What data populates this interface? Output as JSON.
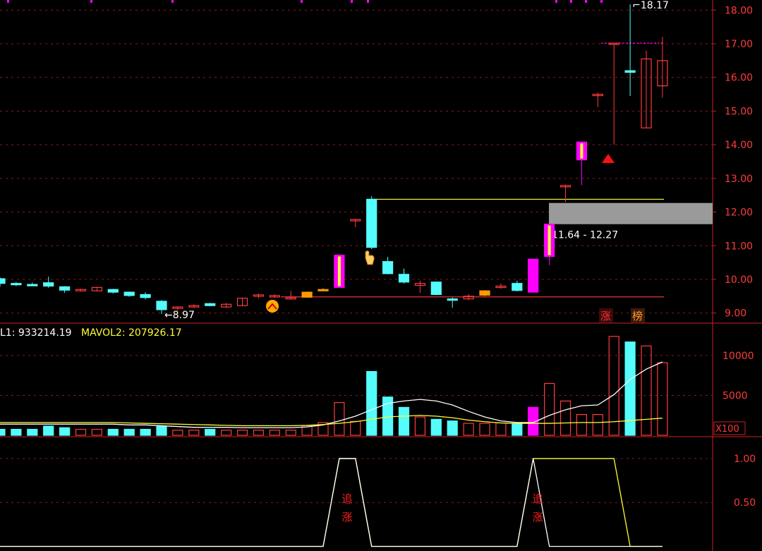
{
  "colors": {
    "up": "#ff3b3b",
    "down": "#54fcfc",
    "limit_up": "#ff00ff",
    "axis": "#cc2020",
    "grid": "#8a1a1a",
    "yellow": "#ffff33",
    "white": "#ffffff",
    "gray_zone": "#9a9a9a"
  },
  "chart_data": [
    {
      "type": "candlestick",
      "ylim": [
        8.7,
        18.3
      ],
      "y_ticks": [
        9.0,
        10.0,
        11.0,
        12.0,
        13.0,
        14.0,
        15.0,
        16.0,
        17.0,
        18.0
      ],
      "candles": [
        {
          "o": 10.02,
          "h": 10.06,
          "l": 9.78,
          "c": 9.88,
          "kind": "down"
        },
        {
          "o": 9.88,
          "h": 9.92,
          "l": 9.8,
          "c": 9.85,
          "kind": "down"
        },
        {
          "o": 9.85,
          "h": 9.9,
          "l": 9.82,
          "c": 9.83,
          "kind": "down"
        },
        {
          "o": 9.9,
          "h": 10.08,
          "l": 9.75,
          "c": 9.8,
          "kind": "down"
        },
        {
          "o": 9.78,
          "h": 9.8,
          "l": 9.6,
          "c": 9.68,
          "kind": "down"
        },
        {
          "o": 9.67,
          "h": 9.72,
          "l": 9.64,
          "c": 9.7,
          "kind": "up"
        },
        {
          "o": 9.66,
          "h": 9.78,
          "l": 9.64,
          "c": 9.76,
          "kind": "up"
        },
        {
          "o": 9.7,
          "h": 9.72,
          "l": 9.58,
          "c": 9.62,
          "kind": "down"
        },
        {
          "o": 9.62,
          "h": 9.64,
          "l": 9.48,
          "c": 9.52,
          "kind": "down"
        },
        {
          "o": 9.55,
          "h": 9.62,
          "l": 9.4,
          "c": 9.46,
          "kind": "down"
        },
        {
          "o": 9.35,
          "h": 9.38,
          "l": 8.97,
          "c": 9.1,
          "kind": "down"
        },
        {
          "o": 9.15,
          "h": 9.2,
          "l": 9.08,
          "c": 9.18,
          "kind": "up"
        },
        {
          "o": 9.2,
          "h": 9.26,
          "l": 9.16,
          "c": 9.22,
          "kind": "up"
        },
        {
          "o": 9.28,
          "h": 9.3,
          "l": 9.2,
          "c": 9.22,
          "kind": "down"
        },
        {
          "o": 9.18,
          "h": 9.3,
          "l": 9.15,
          "c": 9.26,
          "kind": "up"
        },
        {
          "o": 9.22,
          "h": 9.46,
          "l": 9.2,
          "c": 9.44,
          "kind": "up"
        },
        {
          "o": 9.5,
          "h": 9.58,
          "l": 9.44,
          "c": 9.54,
          "kind": "up"
        },
        {
          "o": 9.48,
          "h": 9.56,
          "l": 9.45,
          "c": 9.52,
          "kind": "up"
        },
        {
          "o": 9.42,
          "h": 9.66,
          "l": 9.4,
          "c": 9.46,
          "kind": "up"
        },
        {
          "o": 9.47,
          "h": 9.64,
          "l": 9.45,
          "c": 9.62,
          "kind": "up_solid"
        },
        {
          "o": 9.7,
          "h": 9.74,
          "l": 9.66,
          "c": 9.7,
          "kind": "up_solid"
        },
        {
          "o": 9.76,
          "h": 10.72,
          "l": 9.76,
          "c": 10.72,
          "kind": "limit_up"
        },
        {
          "o": 11.78,
          "h": 11.8,
          "l": 11.55,
          "c": 11.76,
          "kind": "up"
        },
        {
          "o": 12.38,
          "h": 12.47,
          "l": 10.9,
          "c": 10.95,
          "kind": "down"
        },
        {
          "o": 10.53,
          "h": 10.67,
          "l": 10.15,
          "c": 10.17,
          "kind": "down"
        },
        {
          "o": 10.15,
          "h": 10.32,
          "l": 9.88,
          "c": 9.92,
          "kind": "down"
        },
        {
          "o": 9.88,
          "h": 9.96,
          "l": 9.6,
          "c": 9.82,
          "kind": "up"
        },
        {
          "o": 9.92,
          "h": 9.94,
          "l": 9.53,
          "c": 9.55,
          "kind": "down"
        },
        {
          "o": 9.42,
          "h": 9.46,
          "l": 9.16,
          "c": 9.4,
          "kind": "down"
        },
        {
          "o": 9.42,
          "h": 9.56,
          "l": 9.38,
          "c": 9.5,
          "kind": "up"
        },
        {
          "o": 9.53,
          "h": 9.68,
          "l": 9.5,
          "c": 9.66,
          "kind": "up_solid"
        },
        {
          "o": 9.78,
          "h": 9.88,
          "l": 9.72,
          "c": 9.8,
          "kind": "up"
        },
        {
          "o": 9.88,
          "h": 9.96,
          "l": 9.64,
          "c": 9.67,
          "kind": "down"
        },
        {
          "o": 9.62,
          "h": 10.6,
          "l": 9.62,
          "c": 10.6,
          "kind": "limit_up_solid"
        },
        {
          "o": 10.68,
          "h": 11.64,
          "l": 10.42,
          "c": 11.64,
          "kind": "limit_up"
        },
        {
          "o": 12.79,
          "h": 12.81,
          "l": 12.3,
          "c": 12.77,
          "kind": "up"
        },
        {
          "o": 13.55,
          "h": 14.1,
          "l": 12.8,
          "c": 14.08,
          "kind": "limit_up"
        },
        {
          "o": 15.5,
          "h": 15.55,
          "l": 15.12,
          "c": 15.5,
          "kind": "up"
        },
        {
          "o": 17.02,
          "h": 17.02,
          "l": 14.0,
          "c": 17.02,
          "kind": "up"
        },
        {
          "o": 16.2,
          "h": 18.17,
          "l": 15.45,
          "c": 16.15,
          "kind": "down"
        },
        {
          "o": 14.5,
          "h": 16.8,
          "l": 14.5,
          "c": 16.55,
          "kind": "up"
        },
        {
          "o": 15.75,
          "h": 17.2,
          "l": 15.4,
          "c": 16.5,
          "kind": "up"
        }
      ],
      "low_label": "8.97",
      "high_label": "18.17",
      "zone_label": "11.64 - 12.27",
      "zone_range": [
        11.64,
        12.27
      ],
      "support_line": 9.48,
      "resistance_line": 12.38,
      "limit_line": 17.02,
      "tag_zhang": "涨",
      "tag_bang": "榜"
    },
    {
      "type": "bar",
      "legend": [
        "L1: 933214.19",
        "MAVOL2: 207926.17"
      ],
      "ylim": [
        0,
        13000
      ],
      "y_ticks": [
        5000,
        10000
      ],
      "multiplier_label": "X100",
      "volume": [
        750,
        750,
        750,
        1150,
        950,
        750,
        750,
        750,
        750,
        750,
        1100,
        650,
        650,
        750,
        650,
        650,
        650,
        650,
        650,
        1200,
        1600,
        4100,
        1750,
        8000,
        4800,
        3500,
        2300,
        2000,
        1800,
        1500,
        1500,
        1550,
        1500,
        3500,
        6500,
        4300,
        2600,
        2600,
        12400,
        11700,
        11200,
        9100
      ],
      "mavol1": [
        1400,
        1400,
        1400,
        1400,
        1400,
        1400,
        1400,
        1400,
        1300,
        1300,
        1200,
        1100,
        1000,
        1000,
        1000,
        950,
        950,
        950,
        950,
        1050,
        1300,
        1800,
        2400,
        3200,
        4000,
        4300,
        4500,
        4300,
        3800,
        3000,
        2300,
        1800,
        1600,
        1600,
        2500,
        3200,
        3700,
        3800,
        5100,
        7000,
        8300,
        9200
      ],
      "mavol2": [
        1600,
        1600,
        1600,
        1600,
        1600,
        1600,
        1600,
        1600,
        1550,
        1500,
        1450,
        1400,
        1350,
        1300,
        1250,
        1200,
        1200,
        1200,
        1200,
        1250,
        1350,
        1500,
        1700,
        2000,
        2300,
        2400,
        2500,
        2400,
        2200,
        1900,
        1700,
        1550,
        1500,
        1500,
        1500,
        1550,
        1600,
        1600,
        1700,
        1850,
        2000,
        2150
      ]
    },
    {
      "type": "line",
      "ylim": [
        -0.02,
        1.2
      ],
      "y_ticks": [
        0.5,
        1.0
      ],
      "signal_a": [
        0,
        0,
        0,
        0,
        0,
        0,
        0,
        0,
        0,
        0,
        0,
        0,
        0,
        0,
        0,
        0,
        0,
        0,
        0,
        0,
        0,
        1,
        1,
        0,
        0,
        0,
        0,
        0,
        0,
        0,
        0,
        0,
        0,
        1,
        1,
        1,
        1,
        1,
        1,
        0,
        0,
        0
      ],
      "signal_b": [
        0,
        0,
        0,
        0,
        0,
        0,
        0,
        0,
        0,
        0,
        0,
        0,
        0,
        0,
        0,
        0,
        0,
        0,
        0,
        0,
        0,
        1,
        1,
        0,
        0,
        0,
        0,
        0,
        0,
        0,
        0,
        0,
        0,
        1,
        0,
        0,
        0,
        0,
        0,
        0,
        0,
        0
      ],
      "marker": "追\n涨"
    }
  ]
}
